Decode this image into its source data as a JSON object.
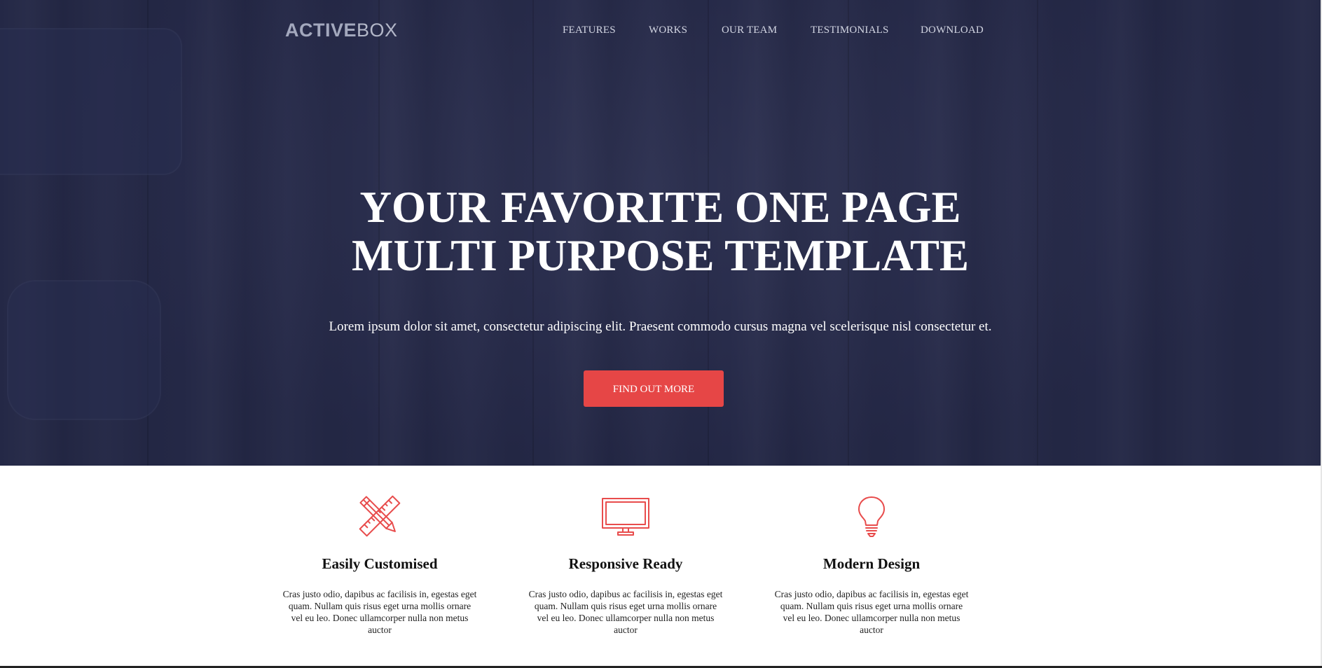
{
  "logo": {
    "bold": "ACTIVE",
    "light": "BOX"
  },
  "nav": {
    "items": [
      "FEATURES",
      "WORKS",
      "OUR TEAM",
      "TESTIMONIALS",
      "DOWNLOAD"
    ]
  },
  "hero": {
    "headline_line1": "YOUR FAVORITE ONE PAGE",
    "headline_line2": "MULTI PURPOSE TEMPLATE",
    "subtext": "Lorem ipsum dolor sit amet, consectetur adipiscing elit. Praesent commodo cursus magna vel scelerisque nisl consectetur et.",
    "cta_label": "FIND OUT MORE"
  },
  "features": [
    {
      "icon": "pencil-ruler-icon",
      "title": "Easily Customised",
      "text": "Cras justo odio, dapibus ac facilisis in, egestas eget quam. Nullam quis risus eget urna mollis ornare vel eu leo. Donec ullamcorper nulla non metus auctor"
    },
    {
      "icon": "monitor-icon",
      "title": "Responsive Ready",
      "text": "Cras justo odio, dapibus ac facilisis in, egestas eget quam. Nullam quis risus eget urna mollis ornare vel eu leo. Donec ullamcorper nulla non metus auctor"
    },
    {
      "icon": "lightbulb-icon",
      "title": "Modern Design",
      "text": "Cras justo odio, dapibus ac facilisis in, egestas eget quam. Nullam quis risus eget urna mollis ornare vel eu leo. Donec ullamcorper nulla non metus auctor"
    }
  ],
  "colors": {
    "hero_bg": "#272b4c",
    "accent": "#e64646",
    "icon_stroke": "#e84c4c"
  }
}
